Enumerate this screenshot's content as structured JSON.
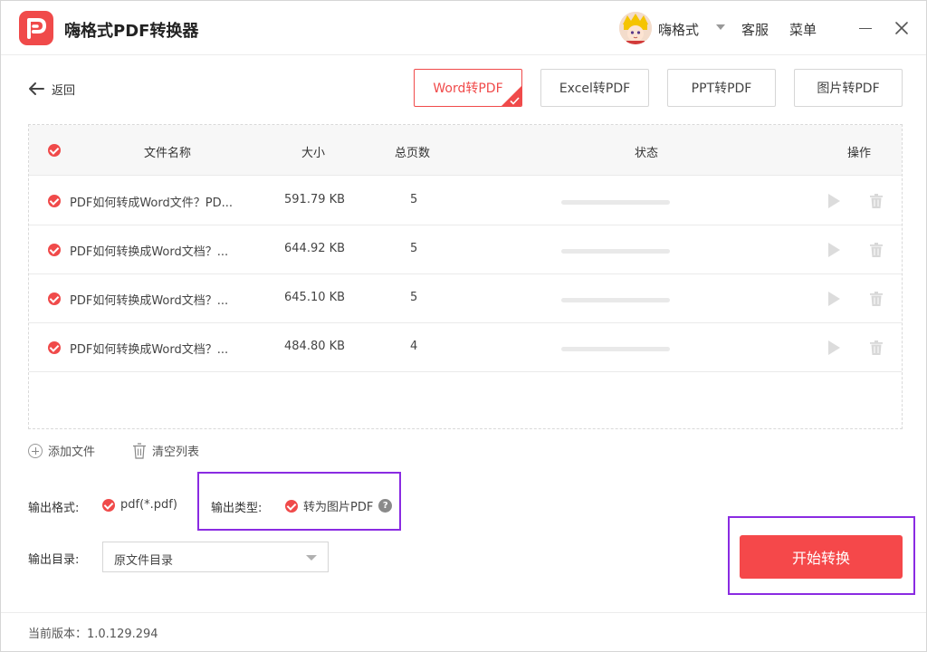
{
  "app": {
    "title": "嗨格式PDF转换器",
    "username": "嗨格式",
    "customer_service": "客服",
    "menu": "菜单"
  },
  "nav": {
    "back_label": "返回",
    "tabs": [
      {
        "label": "Word转PDF",
        "active": true
      },
      {
        "label": "Excel转PDF",
        "active": false
      },
      {
        "label": "PPT转PDF",
        "active": false
      },
      {
        "label": "图片转PDF",
        "active": false
      }
    ]
  },
  "table": {
    "headers": {
      "name": "文件名称",
      "size": "大小",
      "pages": "总页数",
      "status": "状态",
      "actions": "操作"
    },
    "rows": [
      {
        "name": "PDF如何转成Word文件？PD...",
        "size": "591.79 KB",
        "pages": "5"
      },
      {
        "name": "PDF如何转换成Word文档？...",
        "size": "644.92 KB",
        "pages": "5"
      },
      {
        "name": "PDF如何转换成Word文档？...",
        "size": "645.10 KB",
        "pages": "5"
      },
      {
        "name": "PDF如何转换成Word文档？...",
        "size": "484.80 KB",
        "pages": "4"
      }
    ]
  },
  "actions": {
    "add_file": "添加文件",
    "clear_list": "清空列表"
  },
  "output": {
    "format_label": "输出格式:",
    "format_value": "pdf(*.pdf)",
    "type_label": "输出类型:",
    "type_value": "转为图片PDF",
    "dir_label": "输出目录:",
    "dir_value": "原文件目录"
  },
  "start_button": "开始转换",
  "footer": {
    "version": "当前版本：1.0.129.294"
  },
  "colors": {
    "accent": "#f04a4a",
    "highlight": "#8a2be2"
  }
}
